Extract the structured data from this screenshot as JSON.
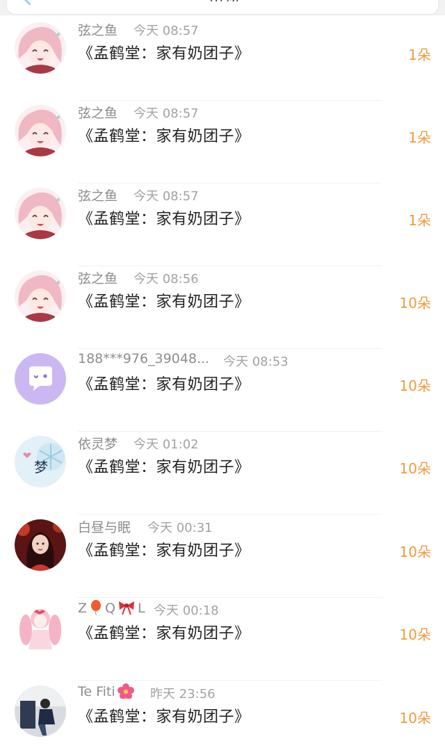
{
  "header": {
    "title": "礼物"
  },
  "colors": {
    "amount": "#f39a3c",
    "name": "#8d8d8d",
    "time": "#a2a2a2",
    "book": "#222222"
  },
  "records": [
    {
      "name": "弦之鱼",
      "time": "今天 08:57",
      "book": "《孟鹤堂：家有奶团子》",
      "amount": "1朵",
      "avatar": "anime-girl-pink-hair"
    },
    {
      "name": "弦之鱼",
      "time": "今天 08:57",
      "book": "《孟鹤堂：家有奶团子》",
      "amount": "1朵",
      "avatar": "anime-girl-pink-hair"
    },
    {
      "name": "弦之鱼",
      "time": "今天 08:57",
      "book": "《孟鹤堂：家有奶团子》",
      "amount": "1朵",
      "avatar": "anime-girl-pink-hair"
    },
    {
      "name": "弦之鱼",
      "time": "今天 08:56",
      "book": "《孟鹤堂：家有奶团子》",
      "amount": "10朵",
      "avatar": "anime-girl-pink-hair"
    },
    {
      "name": "188***976_39048...",
      "time": "今天 08:53",
      "book": "《孟鹤堂：家有奶团子》",
      "amount": "10朵",
      "avatar": "default-chat-bubble"
    },
    {
      "name": "依灵梦",
      "time": "今天 01:02",
      "book": "《孟鹤堂：家有奶团子》",
      "amount": "10朵",
      "avatar": "blue-snowflake-meng",
      "avatar_text": "梦"
    },
    {
      "name": "白昼与眠",
      "time": "今天 00:31",
      "book": "《孟鹤堂：家有奶团子》",
      "amount": "10朵",
      "avatar": "red-costume-girl"
    },
    {
      "name_parts": [
        "Z",
        "Q",
        "L"
      ],
      "name_icons": [
        "balloon-icon",
        "bow-icon"
      ],
      "time": "今天 00:18",
      "book": "《孟鹤堂：家有奶团子》",
      "amount": "10朵",
      "avatar": "pink-twin-tail-girl"
    },
    {
      "name": "Te Fiti",
      "name_icon": "flower-icon",
      "time": "昨天 23:56",
      "book": "《孟鹤堂：家有奶团子》",
      "amount": "10朵",
      "avatar": "person-sitting-dark"
    }
  ]
}
